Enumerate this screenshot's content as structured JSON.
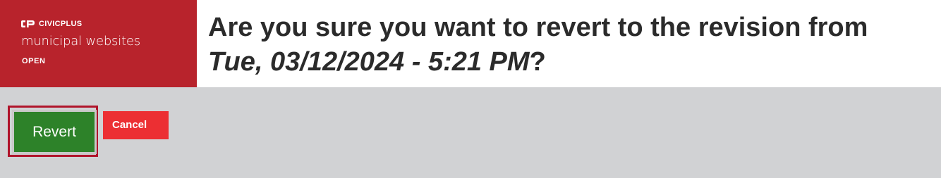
{
  "brand": {
    "name": "CIVICPLUS",
    "product": "municipal websites",
    "tag": "OPEN",
    "logo_icon": "civicplus-logo-icon",
    "background_color": "#b8232c"
  },
  "dialog": {
    "question_prefix": "Are you sure you want to revert to the revision from ",
    "revision_date": "Tue, 03/12/2024 - 5:21 PM",
    "question_suffix": "?"
  },
  "actions": {
    "revert_label": "Revert",
    "cancel_label": "Cancel",
    "revert_color": "#2d8229",
    "cancel_color": "#ec2f33",
    "focus_outline_color": "#b0142a"
  },
  "page": {
    "background_color": "#d1d2d4"
  }
}
